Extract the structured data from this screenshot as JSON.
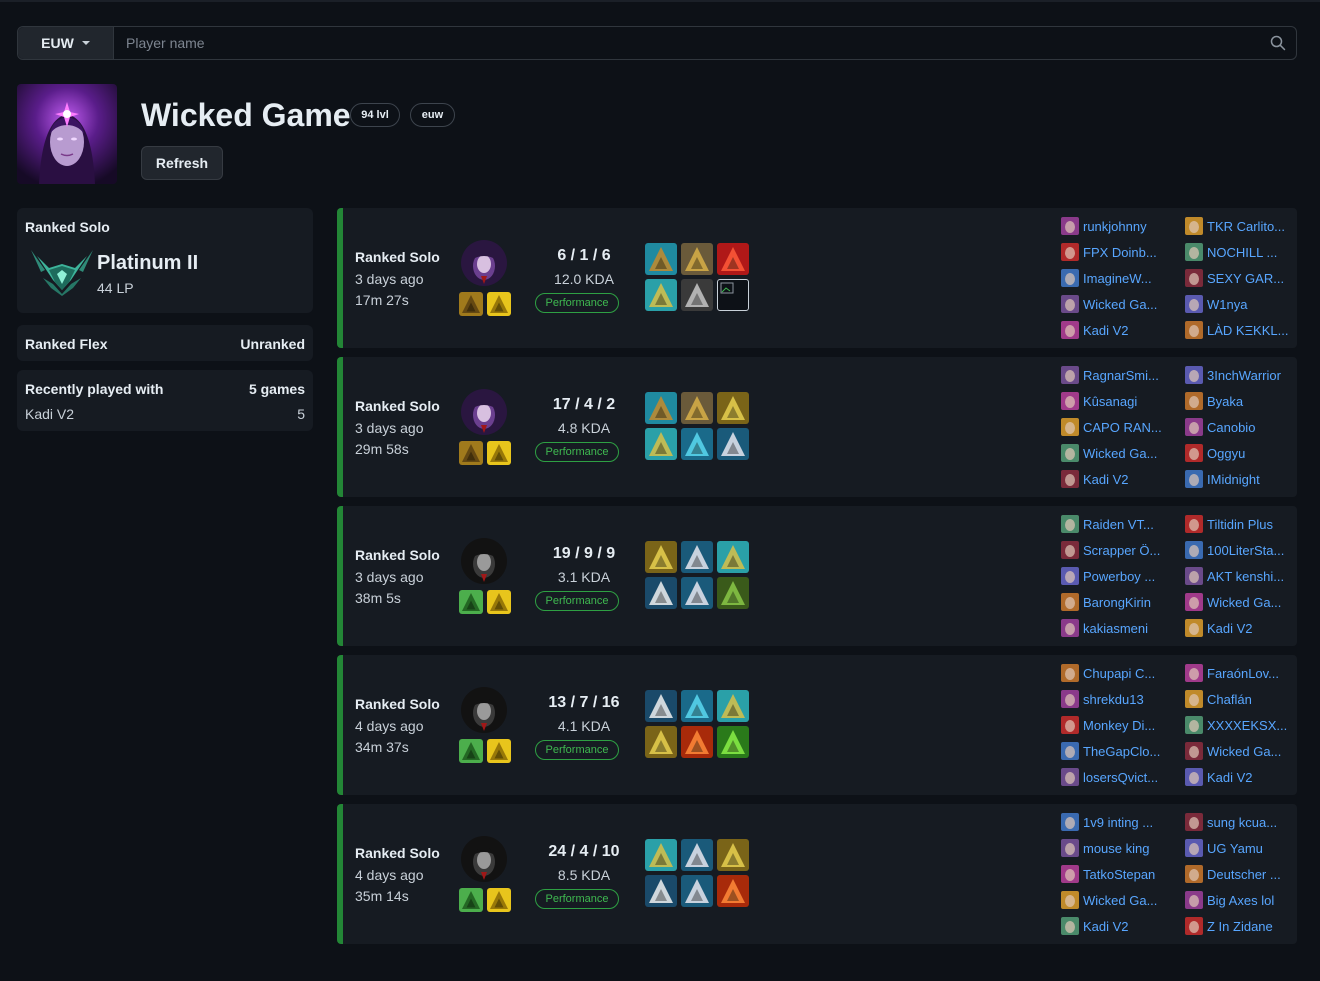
{
  "search": {
    "region": "EUW",
    "placeholder": "Player name",
    "value": ""
  },
  "profile": {
    "name": "Wicked Game",
    "level": "94 lvl",
    "region_tag": "euw",
    "refresh_label": "Refresh"
  },
  "sidebar": {
    "ranked_solo": {
      "title": "Ranked Solo",
      "tier": "Platinum II",
      "lp": "44 LP"
    },
    "ranked_flex": {
      "title": "Ranked Flex",
      "status": "Unranked"
    },
    "recently_played": {
      "title": "Recently played with",
      "count_label": "5 games",
      "players": [
        {
          "name": "Kadi V2",
          "games": "5"
        }
      ]
    }
  },
  "matches": [
    {
      "queue": "Ranked Solo",
      "date": "3 days ago",
      "duration": "17m 27s",
      "kda": "6 / 1 / 6",
      "ratio": "12.0 KDA",
      "perf": "Performance",
      "players": [
        [
          "runkjohnny",
          "FPX Doinb...",
          "ImagineW...",
          "Wicked Ga...",
          "Kadi V2"
        ],
        [
          "TKR Carlito...",
          "NOCHILL ...",
          "SEXY GAR...",
          "W1nya",
          "LÀD KΞKKL..."
        ]
      ]
    },
    {
      "queue": "Ranked Solo",
      "date": "3 days ago",
      "duration": "29m 58s",
      "kda": "17 / 4 / 2",
      "ratio": "4.8 KDA",
      "perf": "Performance",
      "players": [
        [
          "RagnarSmi...",
          "Kûsanagi",
          "CAPO RAN...",
          "Wicked Ga...",
          "Kadi V2"
        ],
        [
          "3InchWarrior",
          "Byaka",
          "Canobio",
          "Oggyu",
          "IMidnight"
        ]
      ]
    },
    {
      "queue": "Ranked Solo",
      "date": "3 days ago",
      "duration": "38m 5s",
      "kda": "19 / 9 / 9",
      "ratio": "3.1 KDA",
      "perf": "Performance",
      "players": [
        [
          "Raiden VT...",
          "Scrapper Ö...",
          "Powerboy ...",
          "BarongKirin",
          "kakiasmeni"
        ],
        [
          "Tiltidin Plus",
          "100LiterSta...",
          "AKT kenshi...",
          "Wicked Ga...",
          "Kadi V2"
        ]
      ]
    },
    {
      "queue": "Ranked Solo",
      "date": "4 days ago",
      "duration": "34m 37s",
      "kda": "13 / 7 / 16",
      "ratio": "4.1 KDA",
      "perf": "Performance",
      "players": [
        [
          "Chupapi C...",
          "shrekdu13",
          "Monkey Di...",
          "TheGapClo...",
          "losersQvict..."
        ],
        [
          "FaraónLov...",
          "Chaflán",
          "XXXXEKSX...",
          "Wicked Ga...",
          "Kadi V2"
        ]
      ]
    },
    {
      "queue": "Ranked Solo",
      "date": "4 days ago",
      "duration": "35m 14s",
      "kda": "24 / 4 / 10",
      "ratio": "8.5 KDA",
      "perf": "Performance",
      "players": [
        [
          "1v9 inting ...",
          "mouse king",
          "TatkoStepan",
          "Wicked Ga...",
          "Kadi V2"
        ],
        [
          "sung kcua...",
          "UG Yamu",
          "Deutscher ...",
          "Big Axes lol",
          "Z In Zidane"
        ]
      ]
    }
  ],
  "colors": {
    "win_border": "#238636",
    "link": "#58a6ff",
    "performance": "#3fb950",
    "card": "#161b22",
    "background": "#0d1117"
  }
}
